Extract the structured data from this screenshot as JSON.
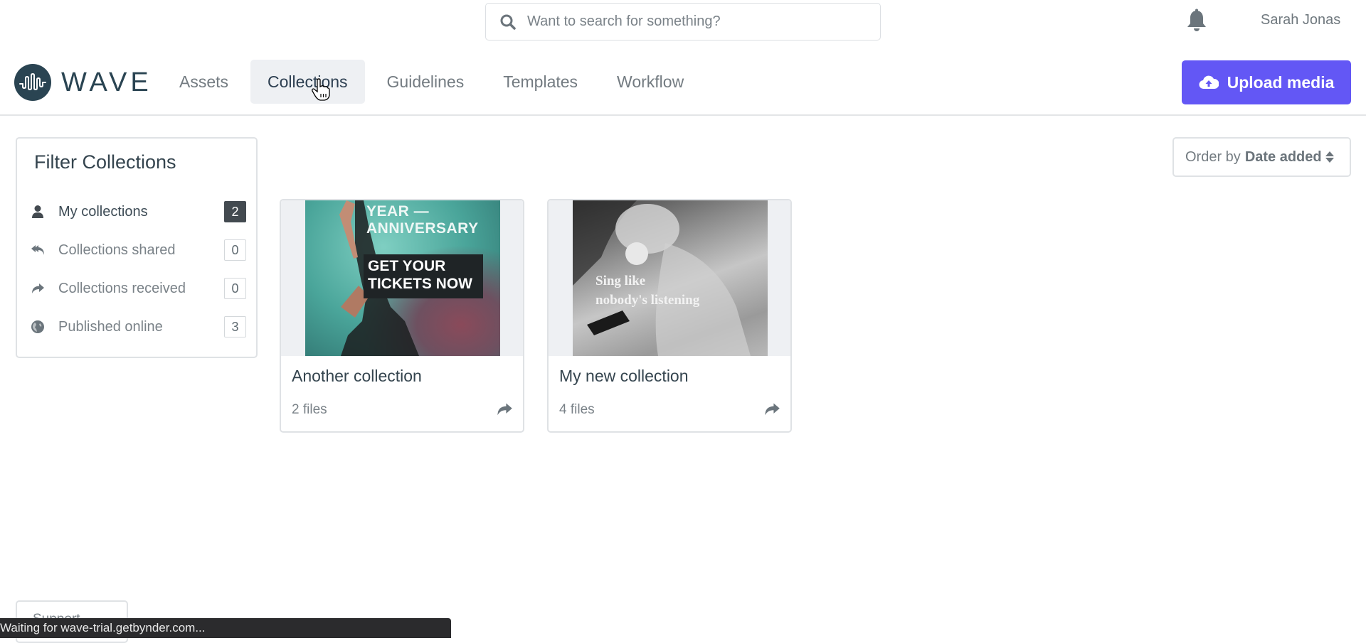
{
  "header": {
    "search_placeholder": "Want to search for something?",
    "user_name": "Sarah Jonas"
  },
  "brand": {
    "logo_text": "WAVE",
    "color": "#2a4452"
  },
  "nav": {
    "items": [
      {
        "label": "Assets",
        "active": false
      },
      {
        "label": "Collections",
        "active": true
      },
      {
        "label": "Guidelines",
        "active": false
      },
      {
        "label": "Templates",
        "active": false
      },
      {
        "label": "Workflow",
        "active": false
      }
    ],
    "upload_label": "Upload media",
    "upload_color": "#6357f5"
  },
  "filter": {
    "title": "Filter Collections",
    "items": [
      {
        "label": "My collections",
        "count": "2",
        "icon": "user-icon",
        "active": true
      },
      {
        "label": "Collections shared",
        "count": "0",
        "icon": "reply-all-icon",
        "active": false
      },
      {
        "label": "Collections received",
        "count": "0",
        "icon": "share-icon",
        "active": false
      },
      {
        "label": "Published online",
        "count": "3",
        "icon": "globe-icon",
        "active": false
      }
    ]
  },
  "order": {
    "prefix": "Order by",
    "value": "Date added"
  },
  "collections": [
    {
      "title": "Another collection",
      "files": "2 files",
      "thumb_text_top": [
        "YEAR —",
        "ANNIVERSARY"
      ],
      "thumb_text_cta": [
        "GET YOUR",
        "TICKETS NOW"
      ]
    },
    {
      "title": "My new collection",
      "files": "4 files",
      "thumb_text": [
        "Sing like",
        "nobody's listening"
      ]
    }
  ],
  "footer": {
    "support_label": "Support",
    "status_text": "Waiting for wave-trial.getbynder.com..."
  }
}
